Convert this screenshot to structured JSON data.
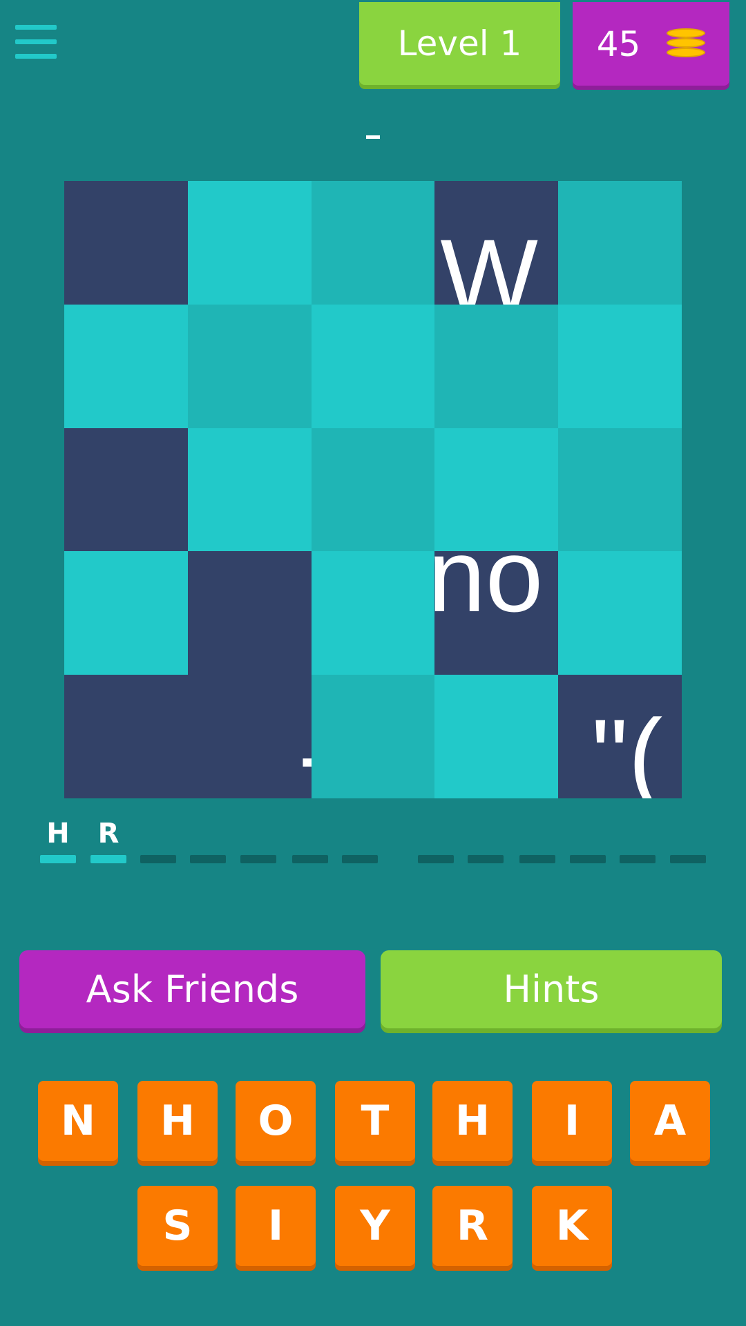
{
  "header": {
    "level_label": "Level 1",
    "coins": "45",
    "hint_text": "-"
  },
  "puzzle": {
    "fragments": [
      "W",
      "no",
      "-",
      "\"("
    ]
  },
  "answer": {
    "letters": [
      "H",
      "R",
      "",
      "",
      "",
      "",
      "",
      "",
      "",
      "",
      "",
      "",
      ""
    ]
  },
  "actions": {
    "ask_friends_label": "Ask Friends",
    "hints_label": "Hints"
  },
  "letter_choices": [
    "N",
    "H",
    "O",
    "T",
    "H",
    "I",
    "A",
    "S",
    "I",
    "Y",
    "R",
    "K"
  ],
  "colors": {
    "background": "#168585",
    "tile_light": "#22c9c9",
    "tile_mid": "#1fb5b5",
    "revealed": "#334268",
    "level_green": "#8ad43f",
    "coins_purple": "#b428c0",
    "key_orange": "#fb7a00"
  }
}
